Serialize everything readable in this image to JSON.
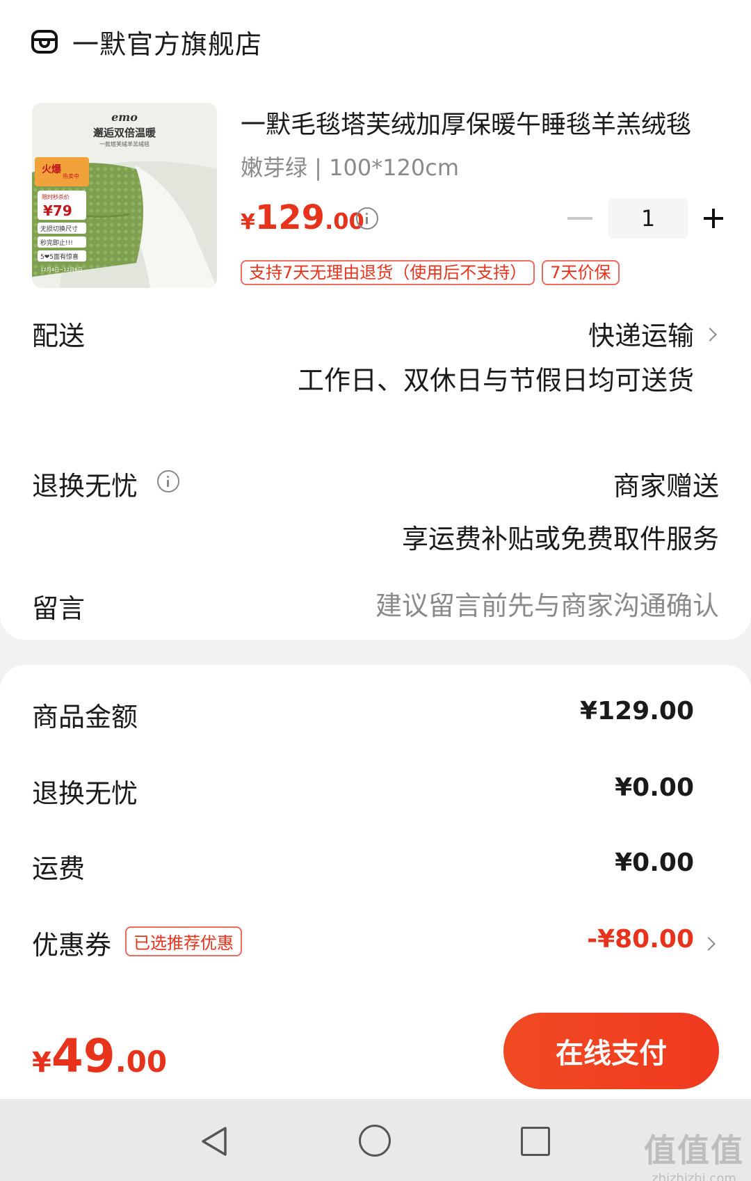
{
  "store": {
    "name": "一默官方旗舰店",
    "icon": "store-icon"
  },
  "product": {
    "image_texts": {
      "brand": "emo",
      "headline": "邂逅双倍温暖",
      "subline": "一款塔芙绒羊羔绒毯",
      "badge_top": "火爆",
      "badge_sub": "热卖中",
      "price_label": "限时秒杀价",
      "price": "¥79",
      "point1": "无损切换尺寸",
      "point2": "秒完即止!!!",
      "point3": "5❤5面有惊喜",
      "dates": "12月4日~12月6日"
    },
    "title": "一默毛毯塔芙绒加厚保暖午睡毯羊羔绒毯",
    "spec": "嫩芽绿 | 100*120cm",
    "price": {
      "currency": "¥",
      "integer": "129",
      "decimal": ".00"
    },
    "quantity": "1",
    "tags": [
      "支持7天无理由退货（使用后不支持）",
      "7天价保"
    ]
  },
  "delivery": {
    "label": "配送",
    "method": "快递运输",
    "note": "工作日、双休日与节假日均可送货"
  },
  "returns": {
    "label": "退换无忧",
    "value": "商家赠送",
    "note": "享运费补贴或免费取件服务"
  },
  "message": {
    "label": "留言",
    "placeholder": "建议留言前先与商家沟通确认"
  },
  "summary": {
    "goods_label": "商品金额",
    "goods_value": "¥129.00",
    "returns_label": "退换无忧",
    "returns_value": "¥0.00",
    "shipping_label": "运费",
    "shipping_value": "¥0.00",
    "coupon_label": "优惠券",
    "coupon_tag": "已选推荐优惠",
    "coupon_value": "-¥80.00"
  },
  "footer": {
    "total": {
      "currency": "¥",
      "integer": "49",
      "decimal": ".00"
    },
    "pay_label": "在线支付"
  },
  "watermark": {
    "main": "值值值",
    "sub": "zhizhizhi.com"
  },
  "colors": {
    "accent": "#e8331c",
    "pay_button": "#f0411f"
  }
}
